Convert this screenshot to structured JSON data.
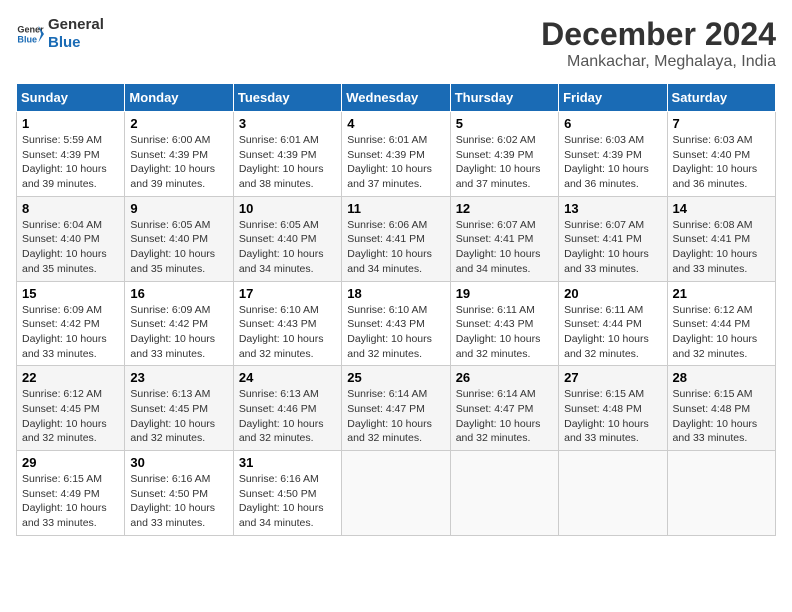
{
  "logo": {
    "line1": "General",
    "line2": "Blue"
  },
  "title": "December 2024",
  "location": "Mankachar, Meghalaya, India",
  "headers": [
    "Sunday",
    "Monday",
    "Tuesday",
    "Wednesday",
    "Thursday",
    "Friday",
    "Saturday"
  ],
  "weeks": [
    [
      {
        "day": "1",
        "sunrise": "5:59 AM",
        "sunset": "4:39 PM",
        "daylight": "10 hours and 39 minutes."
      },
      {
        "day": "2",
        "sunrise": "6:00 AM",
        "sunset": "4:39 PM",
        "daylight": "10 hours and 39 minutes."
      },
      {
        "day": "3",
        "sunrise": "6:01 AM",
        "sunset": "4:39 PM",
        "daylight": "10 hours and 38 minutes."
      },
      {
        "day": "4",
        "sunrise": "6:01 AM",
        "sunset": "4:39 PM",
        "daylight": "10 hours and 37 minutes."
      },
      {
        "day": "5",
        "sunrise": "6:02 AM",
        "sunset": "4:39 PM",
        "daylight": "10 hours and 37 minutes."
      },
      {
        "day": "6",
        "sunrise": "6:03 AM",
        "sunset": "4:39 PM",
        "daylight": "10 hours and 36 minutes."
      },
      {
        "day": "7",
        "sunrise": "6:03 AM",
        "sunset": "4:40 PM",
        "daylight": "10 hours and 36 minutes."
      }
    ],
    [
      {
        "day": "8",
        "sunrise": "6:04 AM",
        "sunset": "4:40 PM",
        "daylight": "10 hours and 35 minutes."
      },
      {
        "day": "9",
        "sunrise": "6:05 AM",
        "sunset": "4:40 PM",
        "daylight": "10 hours and 35 minutes."
      },
      {
        "day": "10",
        "sunrise": "6:05 AM",
        "sunset": "4:40 PM",
        "daylight": "10 hours and 34 minutes."
      },
      {
        "day": "11",
        "sunrise": "6:06 AM",
        "sunset": "4:41 PM",
        "daylight": "10 hours and 34 minutes."
      },
      {
        "day": "12",
        "sunrise": "6:07 AM",
        "sunset": "4:41 PM",
        "daylight": "10 hours and 34 minutes."
      },
      {
        "day": "13",
        "sunrise": "6:07 AM",
        "sunset": "4:41 PM",
        "daylight": "10 hours and 33 minutes."
      },
      {
        "day": "14",
        "sunrise": "6:08 AM",
        "sunset": "4:41 PM",
        "daylight": "10 hours and 33 minutes."
      }
    ],
    [
      {
        "day": "15",
        "sunrise": "6:09 AM",
        "sunset": "4:42 PM",
        "daylight": "10 hours and 33 minutes."
      },
      {
        "day": "16",
        "sunrise": "6:09 AM",
        "sunset": "4:42 PM",
        "daylight": "10 hours and 33 minutes."
      },
      {
        "day": "17",
        "sunrise": "6:10 AM",
        "sunset": "4:43 PM",
        "daylight": "10 hours and 32 minutes."
      },
      {
        "day": "18",
        "sunrise": "6:10 AM",
        "sunset": "4:43 PM",
        "daylight": "10 hours and 32 minutes."
      },
      {
        "day": "19",
        "sunrise": "6:11 AM",
        "sunset": "4:43 PM",
        "daylight": "10 hours and 32 minutes."
      },
      {
        "day": "20",
        "sunrise": "6:11 AM",
        "sunset": "4:44 PM",
        "daylight": "10 hours and 32 minutes."
      },
      {
        "day": "21",
        "sunrise": "6:12 AM",
        "sunset": "4:44 PM",
        "daylight": "10 hours and 32 minutes."
      }
    ],
    [
      {
        "day": "22",
        "sunrise": "6:12 AM",
        "sunset": "4:45 PM",
        "daylight": "10 hours and 32 minutes."
      },
      {
        "day": "23",
        "sunrise": "6:13 AM",
        "sunset": "4:45 PM",
        "daylight": "10 hours and 32 minutes."
      },
      {
        "day": "24",
        "sunrise": "6:13 AM",
        "sunset": "4:46 PM",
        "daylight": "10 hours and 32 minutes."
      },
      {
        "day": "25",
        "sunrise": "6:14 AM",
        "sunset": "4:47 PM",
        "daylight": "10 hours and 32 minutes."
      },
      {
        "day": "26",
        "sunrise": "6:14 AM",
        "sunset": "4:47 PM",
        "daylight": "10 hours and 32 minutes."
      },
      {
        "day": "27",
        "sunrise": "6:15 AM",
        "sunset": "4:48 PM",
        "daylight": "10 hours and 33 minutes."
      },
      {
        "day": "28",
        "sunrise": "6:15 AM",
        "sunset": "4:48 PM",
        "daylight": "10 hours and 33 minutes."
      }
    ],
    [
      {
        "day": "29",
        "sunrise": "6:15 AM",
        "sunset": "4:49 PM",
        "daylight": "10 hours and 33 minutes."
      },
      {
        "day": "30",
        "sunrise": "6:16 AM",
        "sunset": "4:50 PM",
        "daylight": "10 hours and 33 minutes."
      },
      {
        "day": "31",
        "sunrise": "6:16 AM",
        "sunset": "4:50 PM",
        "daylight": "10 hours and 34 minutes."
      },
      null,
      null,
      null,
      null
    ]
  ],
  "labels": {
    "sunrise": "Sunrise:",
    "sunset": "Sunset:",
    "daylight": "Daylight:"
  }
}
